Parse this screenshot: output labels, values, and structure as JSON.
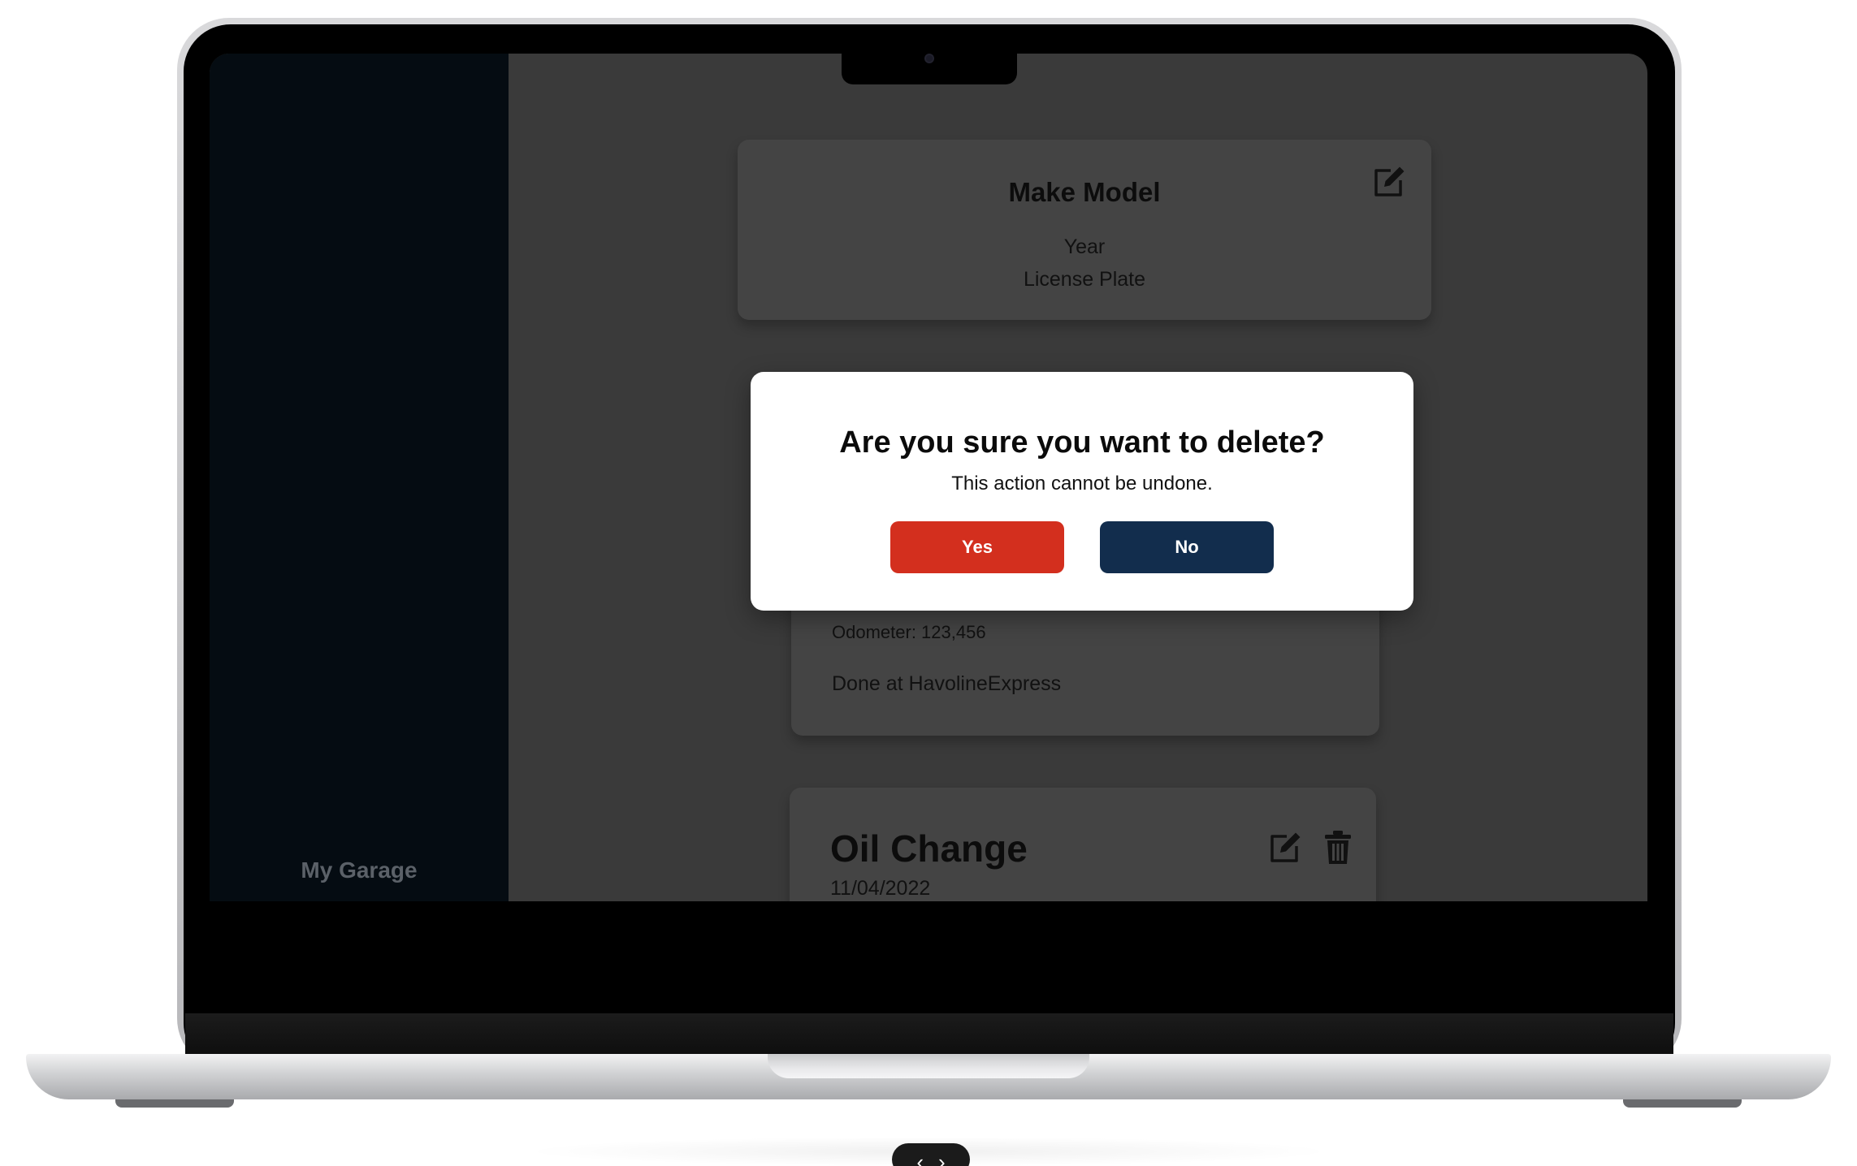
{
  "sidebar": {
    "label": "My Garage"
  },
  "car": {
    "title": "Make Model",
    "year": "Year",
    "plate": "License Plate"
  },
  "service_card": {
    "odometer": "Odometer: 123,456",
    "location": "Done at HavolineExpress"
  },
  "oil_card": {
    "title": "Oil Change",
    "date": "11/04/2022"
  },
  "modal": {
    "title": "Are you sure you want to delete?",
    "message": "This action cannot be undone.",
    "yes_label": "Yes",
    "no_label": "No"
  },
  "colors": {
    "danger": "#d32f1e",
    "primary": "#122d4d",
    "sidebar_bg": "#050c12",
    "overlay_bg": "#3a3a3a",
    "card_bg": "#444444"
  },
  "icons": {
    "car_card": "edit-icon",
    "oil_card": [
      "edit-icon",
      "trash-icon"
    ],
    "pager": [
      "chevron-left-icon",
      "chevron-right-icon"
    ]
  }
}
